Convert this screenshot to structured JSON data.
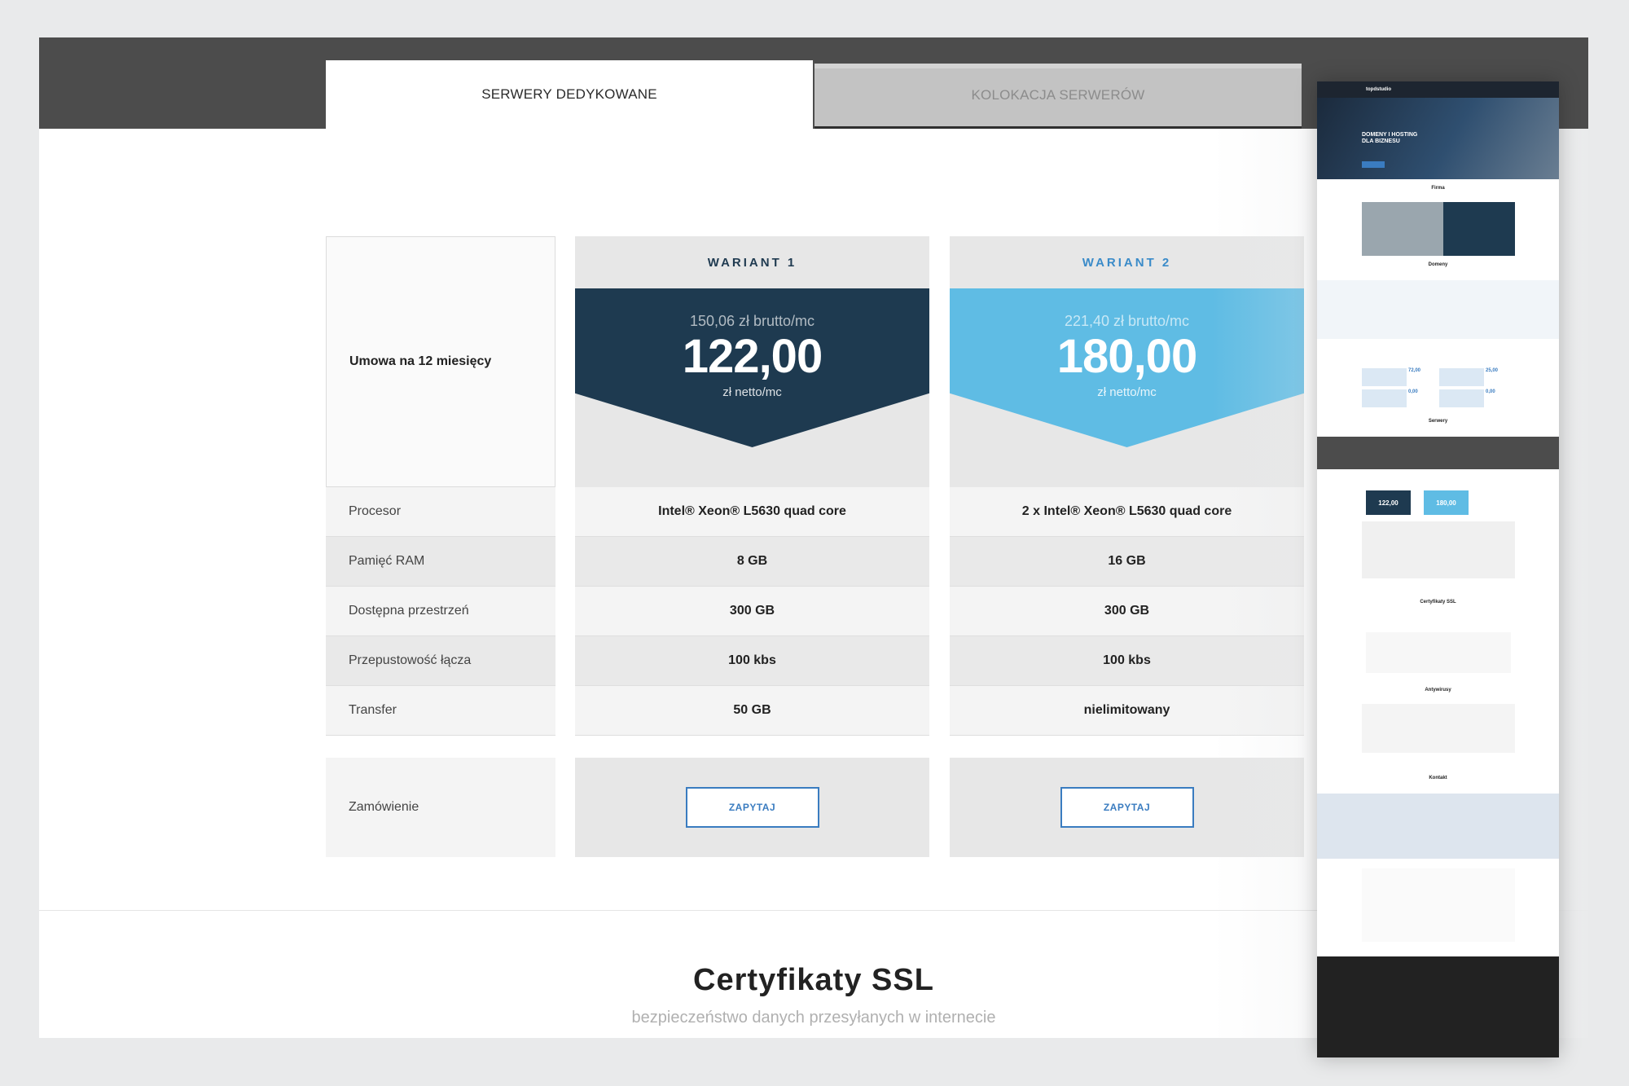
{
  "tabs": [
    {
      "label": "SERWERY DEDYKOWANE",
      "active": true
    },
    {
      "label": "KOLOKACJA SERWERÓW",
      "active": false
    }
  ],
  "pricing": {
    "contract_label": "Umowa na 12 miesięcy",
    "rows": [
      "Procesor",
      "Pamięć RAM",
      "Dostępna przestrzeń",
      "Przepustowość łącza",
      "Transfer"
    ],
    "order_label": "Zamówienie",
    "plans": [
      {
        "title": "WARIANT 1",
        "gross": "150,06 zł brutto/mc",
        "net": "122,00",
        "net_unit": "zł netto/mc",
        "values": [
          "Intel® Xeon® L5630 quad core",
          "8 GB",
          "300 GB",
          "100 kbs",
          "50 GB"
        ],
        "button": "ZAPYTAJ"
      },
      {
        "title": "WARIANT 2",
        "gross": "221,40 zł brutto/mc",
        "net": "180,00",
        "net_unit": "zł netto/mc",
        "values": [
          "2 x Intel® Xeon® L5630 quad core",
          "16 GB",
          "300 GB",
          "100 kbs",
          "nielimitowany"
        ],
        "button": "ZAPYTAJ"
      }
    ]
  },
  "ssl": {
    "title": "Certyfikaty SSL",
    "subtitle": "bezpieczeństwo danych przesyłanych w internecie"
  },
  "preview": {
    "logo": "topdstudio",
    "hero_title": "DOMENY I HOSTING DLA BIZNESU",
    "sections": [
      "Firma",
      "Domeny",
      "Serwery",
      "Certyfikaty SSL",
      "Antywirusy",
      "Kontakt"
    ],
    "prices": [
      "122,00",
      "180,00",
      "72,00",
      "25,00",
      "0,00",
      "0,00"
    ]
  },
  "colors": {
    "band": "#4c4c4c",
    "plan1": "#1e3a50",
    "plan2": "#5fbce4",
    "button": "#3a7cc0"
  }
}
